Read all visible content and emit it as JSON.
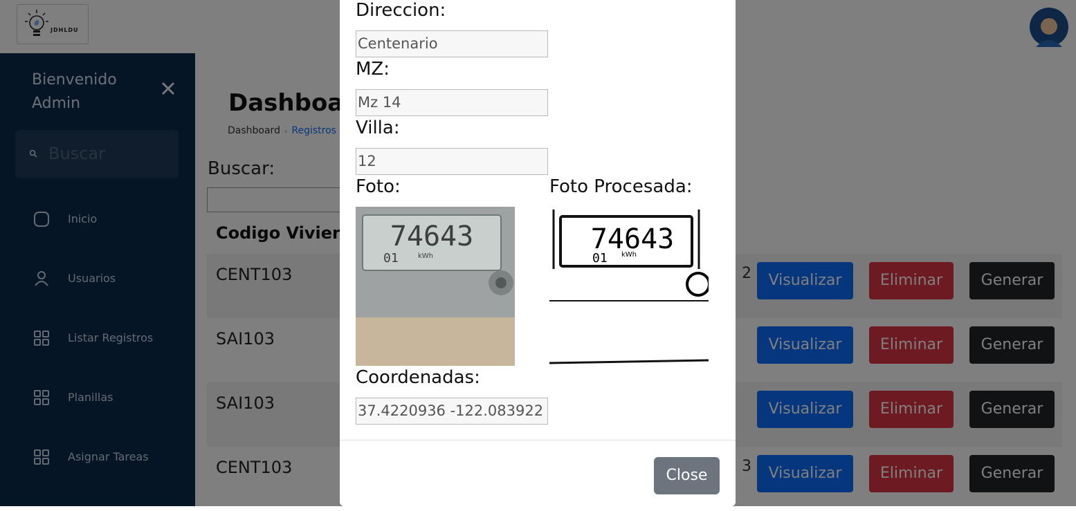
{
  "app": {
    "brand": "JDHLDU"
  },
  "sidebar": {
    "welcome_line1": "Bienvenido",
    "welcome_line2": "Admin",
    "search_placeholder": "Buscar",
    "items": [
      {
        "label": "Inicio",
        "icon": "square-icon"
      },
      {
        "label": "Usuarios",
        "icon": "user-icon"
      },
      {
        "label": "Listar Registros",
        "icon": "grid-icon"
      },
      {
        "label": "Planillas",
        "icon": "grid-icon"
      },
      {
        "label": "Asignar Tareas",
        "icon": "grid-icon"
      }
    ]
  },
  "main": {
    "title": "Dashboard",
    "breadcrumb": {
      "home": "Dashboard",
      "current": "Registros"
    },
    "search_label": "Buscar:",
    "search_value": "",
    "column_header": "Codigo Vivienda",
    "rows": [
      {
        "code": "CENT103",
        "frag": "2"
      },
      {
        "code": "SAI103",
        "frag": ""
      },
      {
        "code": "SAI103",
        "frag": ""
      },
      {
        "code": "CENT103",
        "frag": "3"
      }
    ],
    "buttons": {
      "visualizar": "Visualizar",
      "eliminar": "Eliminar",
      "generar": "Generar"
    }
  },
  "modal": {
    "direccion_label": "Direccion:",
    "direccion_value": "Centenario",
    "mz_label": "MZ:",
    "mz_value": "Mz 14",
    "villa_label": "Villa:",
    "villa_value": "12",
    "foto_label": "Foto:",
    "foto_procesada_label": "Foto Procesada:",
    "meter_reading": "74643",
    "meter_sub": "01",
    "meter_unit": "kWh",
    "coordenadas_label": "Coordenadas:",
    "coordenadas_value": "37.4220936 -122.083922",
    "close_label": "Close"
  },
  "colors": {
    "sidebar_bg": "#0b2a4b",
    "primary": "#0d6efd",
    "danger": "#dc3545",
    "dark": "#212529",
    "secondary": "#6c757d"
  }
}
